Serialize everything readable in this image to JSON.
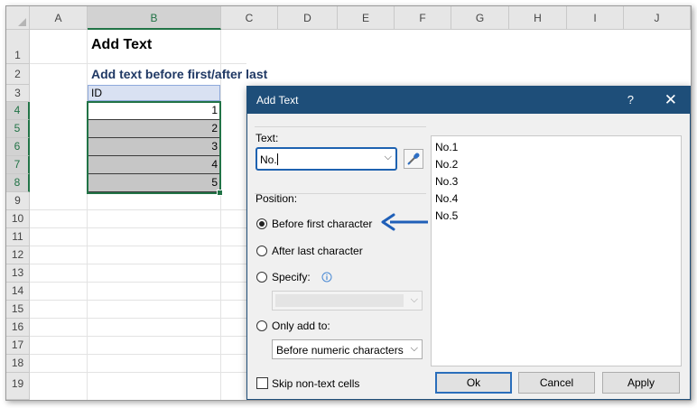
{
  "sheet": {
    "columns": [
      "A",
      "B",
      "C",
      "D",
      "E",
      "F",
      "G",
      "H",
      "I",
      "J"
    ],
    "selected_column": "B",
    "rows": [
      "1",
      "2",
      "3",
      "4",
      "5",
      "6",
      "7",
      "8",
      "9",
      "10",
      "11",
      "12",
      "13",
      "14",
      "15",
      "16",
      "17",
      "18",
      "19"
    ],
    "selected_rows": [
      "4",
      "5",
      "6",
      "7",
      "8"
    ],
    "title": "Add Text",
    "subtitle": "Add text before first/after last",
    "id_header": "ID",
    "id_values": [
      "1",
      "2",
      "3",
      "4",
      "5"
    ]
  },
  "dialog": {
    "title": "Add Text",
    "help": "?",
    "close": "✕",
    "text_label": "Text:",
    "text_value": "No.",
    "position_label": "Position:",
    "options": {
      "before_first": "Before first character",
      "after_last": "After last character",
      "specify": "Specify:",
      "only_add_to": "Only add to:"
    },
    "selected_option": "before_first",
    "only_add_to_value": "Before numeric characters",
    "preview_lines": [
      "No.1",
      "No.2",
      "No.3",
      "No.4",
      "No.5"
    ],
    "skip_non_text": "Skip non-text cells",
    "skip_non_text_checked": false,
    "buttons": {
      "ok": "Ok",
      "cancel": "Cancel",
      "apply": "Apply"
    }
  },
  "colors": {
    "title_bar": "#1e4e79",
    "excel_green": "#217346",
    "arrow": "#1f5fb8",
    "subtitle": "#1f3864"
  },
  "icons": {
    "dropdown": "chevron-down-icon",
    "eyedropper": "eyedropper-icon",
    "info": "info-icon",
    "arrow": "arrow-left-icon"
  }
}
